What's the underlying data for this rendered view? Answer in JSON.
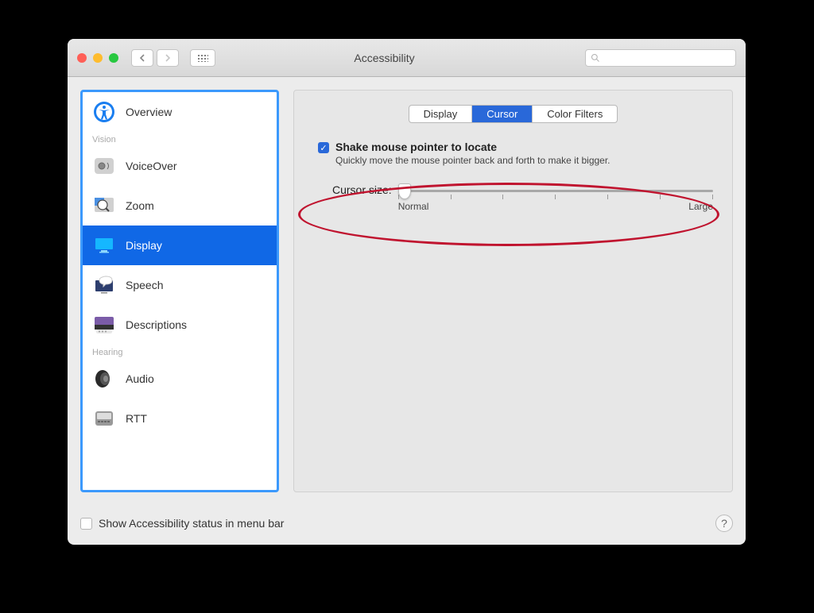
{
  "window_title": "Accessibility",
  "sidebar": {
    "items": [
      {
        "label": "Overview"
      },
      {
        "label": "VoiceOver",
        "cat": "Vision"
      },
      {
        "label": "Zoom"
      },
      {
        "label": "Display",
        "selected": true
      },
      {
        "label": "Speech"
      },
      {
        "label": "Descriptions"
      },
      {
        "label": "Audio",
        "cat": "Hearing"
      },
      {
        "label": "RTT"
      }
    ],
    "cat_vision": "Vision",
    "cat_hearing": "Hearing"
  },
  "tabs": [
    "Display",
    "Cursor",
    "Color Filters"
  ],
  "active_tab": 1,
  "shake": {
    "label": "Shake mouse pointer to locate",
    "desc": "Quickly move the mouse pointer back and forth to make it bigger.",
    "checked": true
  },
  "slider": {
    "label": "Cursor size:",
    "min_label": "Normal",
    "max_label": "Large",
    "value": 0
  },
  "footer": {
    "label": "Show Accessibility status in menu bar",
    "checked": false
  },
  "help": "?"
}
